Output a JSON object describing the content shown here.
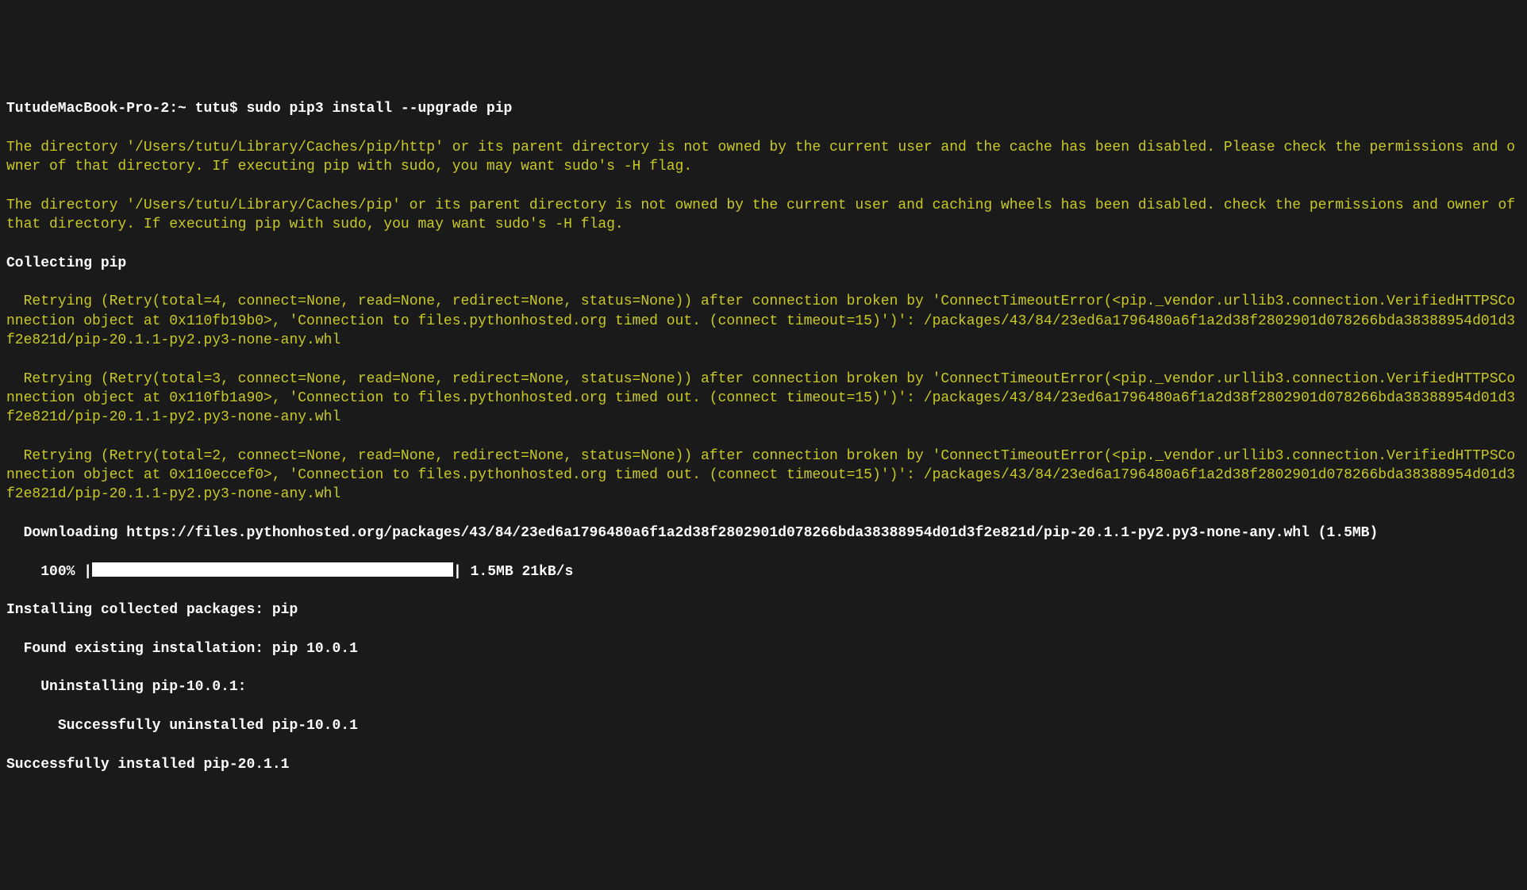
{
  "terminal": {
    "prompt": "TutudeMacBook-Pro-2:~ tutu$ sudo pip3 install --upgrade pip",
    "warning1": "The directory '/Users/tutu/Library/Caches/pip/http' or its parent directory is not owned by the current user and the cache has been disabled. Please check the permissions and owner of that directory. If executing pip with sudo, you may want sudo's -H flag.",
    "warning2": "The directory '/Users/tutu/Library/Caches/pip' or its parent directory is not owned by the current user and caching wheels has been disabled. check the permissions and owner of that directory. If executing pip with sudo, you may want sudo's -H flag.",
    "collecting": "Collecting pip",
    "retry1": "  Retrying (Retry(total=4, connect=None, read=None, redirect=None, status=None)) after connection broken by 'ConnectTimeoutError(<pip._vendor.urllib3.connection.VerifiedHTTPSConnection object at 0x110fb19b0>, 'Connection to files.pythonhosted.org timed out. (connect timeout=15)')': /packages/43/84/23ed6a1796480a6f1a2d38f2802901d078266bda38388954d01d3f2e821d/pip-20.1.1-py2.py3-none-any.whl",
    "retry2": "  Retrying (Retry(total=3, connect=None, read=None, redirect=None, status=None)) after connection broken by 'ConnectTimeoutError(<pip._vendor.urllib3.connection.VerifiedHTTPSConnection object at 0x110fb1a90>, 'Connection to files.pythonhosted.org timed out. (connect timeout=15)')': /packages/43/84/23ed6a1796480a6f1a2d38f2802901d078266bda38388954d01d3f2e821d/pip-20.1.1-py2.py3-none-any.whl",
    "retry3": "  Retrying (Retry(total=2, connect=None, read=None, redirect=None, status=None)) after connection broken by 'ConnectTimeoutError(<pip._vendor.urllib3.connection.VerifiedHTTPSConnection object at 0x110eccef0>, 'Connection to files.pythonhosted.org timed out. (connect timeout=15)')': /packages/43/84/23ed6a1796480a6f1a2d38f2802901d078266bda38388954d01d3f2e821d/pip-20.1.1-py2.py3-none-any.whl",
    "downloading": "  Downloading https://files.pythonhosted.org/packages/43/84/23ed6a1796480a6f1a2d38f2802901d078266bda38388954d01d3f2e821d/pip-20.1.1-py2.py3-none-any.whl (1.5MB)",
    "progress_percent": "    100% |",
    "progress_suffix": "| 1.5MB 21kB/s",
    "installing": "Installing collected packages: pip",
    "found_existing": "  Found existing installation: pip 10.0.1",
    "uninstalling": "    Uninstalling pip-10.0.1:",
    "uninstalled": "      Successfully uninstalled pip-10.0.1",
    "success": "Successfully installed pip-20.1.1"
  }
}
